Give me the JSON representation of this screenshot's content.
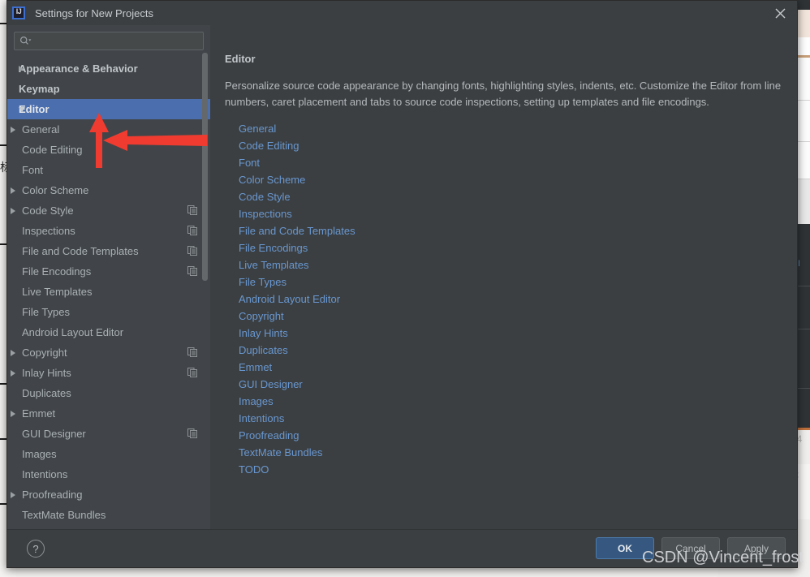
{
  "window": {
    "title": "Settings for New Projects",
    "app_icon": "intellij-idea-icon",
    "close_icon": "close-icon"
  },
  "colors": {
    "dialog_bg": "#3c3f41",
    "sidebar_bg": "#414549",
    "selection_blue": "#4b6eaf",
    "link_blue": "#6897d0",
    "primary_button": "#365880",
    "annotation_red": "#f03c30"
  },
  "search": {
    "value": "",
    "placeholder": "",
    "icon": "search-icon"
  },
  "sidebar": {
    "items": [
      {
        "label": "Appearance & Behavior",
        "level": 0,
        "arrow": "collapsed",
        "bold": true,
        "selected": false,
        "copy": false
      },
      {
        "label": "Keymap",
        "level": 0,
        "arrow": "none",
        "bold": true,
        "selected": false,
        "copy": false
      },
      {
        "label": "Editor",
        "level": 0,
        "arrow": "expanded",
        "bold": true,
        "selected": true,
        "copy": false
      },
      {
        "label": "General",
        "level": 1,
        "arrow": "collapsed",
        "bold": false,
        "selected": false,
        "copy": false
      },
      {
        "label": "Code Editing",
        "level": 1,
        "arrow": "none",
        "bold": false,
        "selected": false,
        "copy": false
      },
      {
        "label": "Font",
        "level": 1,
        "arrow": "none",
        "bold": false,
        "selected": false,
        "copy": false
      },
      {
        "label": "Color Scheme",
        "level": 1,
        "arrow": "collapsed",
        "bold": false,
        "selected": false,
        "copy": false
      },
      {
        "label": "Code Style",
        "level": 1,
        "arrow": "collapsed",
        "bold": false,
        "selected": false,
        "copy": true
      },
      {
        "label": "Inspections",
        "level": 1,
        "arrow": "none",
        "bold": false,
        "selected": false,
        "copy": true
      },
      {
        "label": "File and Code Templates",
        "level": 1,
        "arrow": "none",
        "bold": false,
        "selected": false,
        "copy": true
      },
      {
        "label": "File Encodings",
        "level": 1,
        "arrow": "none",
        "bold": false,
        "selected": false,
        "copy": true
      },
      {
        "label": "Live Templates",
        "level": 1,
        "arrow": "none",
        "bold": false,
        "selected": false,
        "copy": false
      },
      {
        "label": "File Types",
        "level": 1,
        "arrow": "none",
        "bold": false,
        "selected": false,
        "copy": false
      },
      {
        "label": "Android Layout Editor",
        "level": 1,
        "arrow": "none",
        "bold": false,
        "selected": false,
        "copy": false
      },
      {
        "label": "Copyright",
        "level": 1,
        "arrow": "collapsed",
        "bold": false,
        "selected": false,
        "copy": true
      },
      {
        "label": "Inlay Hints",
        "level": 1,
        "arrow": "collapsed",
        "bold": false,
        "selected": false,
        "copy": true
      },
      {
        "label": "Duplicates",
        "level": 1,
        "arrow": "none",
        "bold": false,
        "selected": false,
        "copy": false
      },
      {
        "label": "Emmet",
        "level": 1,
        "arrow": "collapsed",
        "bold": false,
        "selected": false,
        "copy": false
      },
      {
        "label": "GUI Designer",
        "level": 1,
        "arrow": "none",
        "bold": false,
        "selected": false,
        "copy": true
      },
      {
        "label": "Images",
        "level": 1,
        "arrow": "none",
        "bold": false,
        "selected": false,
        "copy": false
      },
      {
        "label": "Intentions",
        "level": 1,
        "arrow": "none",
        "bold": false,
        "selected": false,
        "copy": false
      },
      {
        "label": "Proofreading",
        "level": 1,
        "arrow": "collapsed",
        "bold": false,
        "selected": false,
        "copy": false
      },
      {
        "label": "TextMate Bundles",
        "level": 1,
        "arrow": "none",
        "bold": false,
        "selected": false,
        "copy": false
      },
      {
        "label": "TODO",
        "level": 1,
        "arrow": "none",
        "bold": false,
        "selected": false,
        "copy": false
      }
    ]
  },
  "content": {
    "title": "Editor",
    "description": "Personalize source code appearance by changing fonts, highlighting styles, indents, etc. Customize the Editor from line numbers, caret placement and tabs to source code inspections, setting up templates and file encodings.",
    "links": [
      "General",
      "Code Editing",
      "Font",
      "Color Scheme",
      "Code Style",
      "Inspections",
      "File and Code Templates",
      "File Encodings",
      "Live Templates",
      "File Types",
      "Android Layout Editor",
      "Copyright",
      "Inlay Hints",
      "Duplicates",
      "Emmet",
      "GUI Designer",
      "Images",
      "Intentions",
      "Proofreading",
      "TextMate Bundles",
      "TODO"
    ]
  },
  "footer": {
    "help_label": "?",
    "ok_label": "OK",
    "cancel_label": "Cancel",
    "apply_label": "Apply"
  },
  "watermark": {
    "text": "CSDN @Vincent_frost"
  },
  "background": {
    "cjk_char": "标"
  }
}
